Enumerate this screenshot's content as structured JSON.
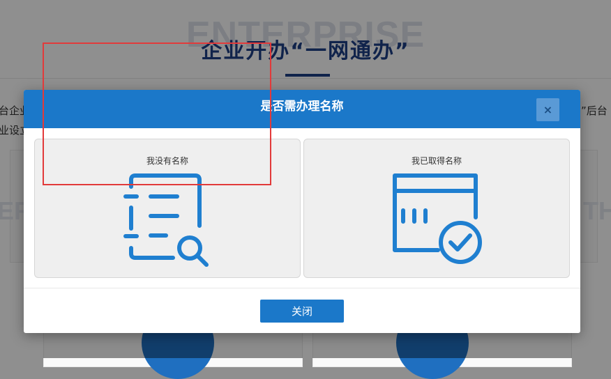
{
  "background": {
    "watermark": "ENTERPRISE",
    "title": "企业开办“一网通办”",
    "left_text_line1": "台企业",
    "left_text_line2": "业设立",
    "right_text_line1": "”后台",
    "side_watermark_left": "ER",
    "side_watermark_right": "TH"
  },
  "modal": {
    "title": "是否需办理名称",
    "close_icon": "×",
    "options": [
      {
        "label": "我没有名称",
        "icon": "document-search-icon"
      },
      {
        "label": "我已取得名称",
        "icon": "calendar-check-icon"
      }
    ],
    "close_button_label": "关闭"
  },
  "colors": {
    "primary": "#1b78c9",
    "icon_blue": "#1f7fd0",
    "highlight": "#e23a3a",
    "title_navy": "#1e3f87"
  }
}
